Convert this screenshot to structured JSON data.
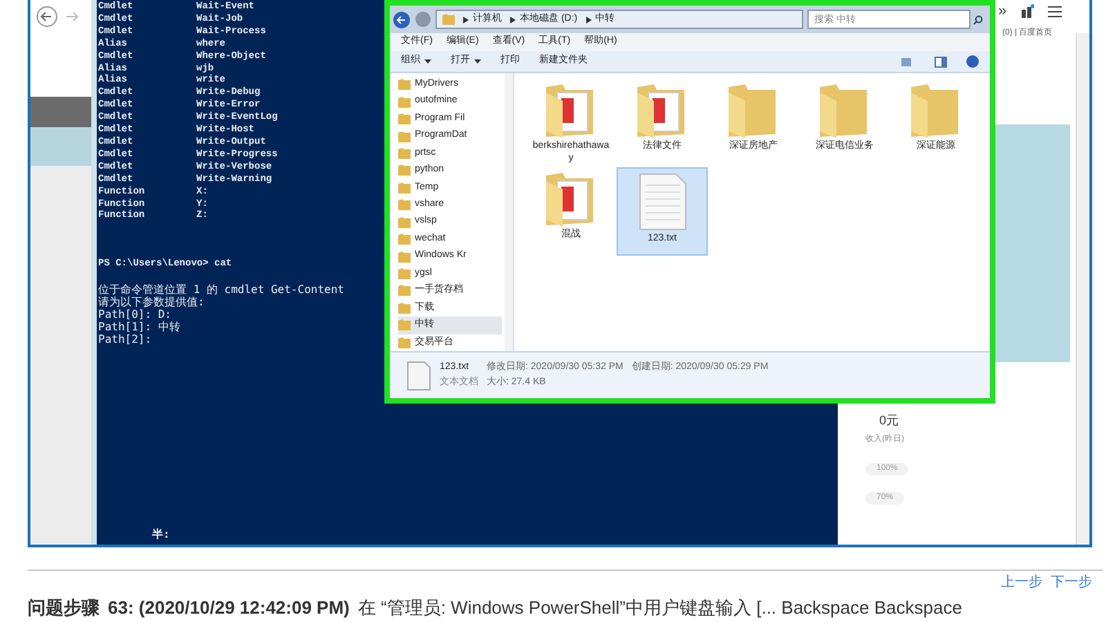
{
  "console": {
    "table": [
      {
        "type": "Cmdlet",
        "name": "Wait-Event"
      },
      {
        "type": "Cmdlet",
        "name": "Wait-Job"
      },
      {
        "type": "Cmdlet",
        "name": "Wait-Process"
      },
      {
        "type": "Alias",
        "name": "where"
      },
      {
        "type": "Cmdlet",
        "name": "Where-Object"
      },
      {
        "type": "Alias",
        "name": "wjb"
      },
      {
        "type": "Alias",
        "name": "write"
      },
      {
        "type": "Cmdlet",
        "name": "Write-Debug"
      },
      {
        "type": "Cmdlet",
        "name": "Write-Error"
      },
      {
        "type": "Cmdlet",
        "name": "Write-EventLog"
      },
      {
        "type": "Cmdlet",
        "name": "Write-Host"
      },
      {
        "type": "Cmdlet",
        "name": "Write-Output"
      },
      {
        "type": "Cmdlet",
        "name": "Write-Progress"
      },
      {
        "type": "Cmdlet",
        "name": "Write-Verbose"
      },
      {
        "type": "Cmdlet",
        "name": "Write-Warning"
      },
      {
        "type": "Function",
        "name": "X:"
      },
      {
        "type": "Function",
        "name": "Y:"
      },
      {
        "type": "Function",
        "name": "Z:"
      }
    ],
    "prompt": "PS C:\\Users\\Lenovo> cat",
    "lines": [
      "位于命令管道位置 1 的 cmdlet Get-Content",
      "请为以下参数提供值:",
      "Path[0]: D:",
      "Path[1]: 中转",
      "Path[2]:"
    ],
    "ime_status": "半:"
  },
  "explorer": {
    "breadcrumbs": [
      "计算机",
      "本地磁盘 (D:)",
      "中转"
    ],
    "search": {
      "placeholder": "搜索 中转"
    },
    "menu": [
      "文件(F)",
      "编辑(E)",
      "查看(V)",
      "工具(T)",
      "帮助(H)"
    ],
    "toolbar": [
      {
        "label": "组织",
        "dropdown": true
      },
      {
        "label": "打开",
        "dropdown": true
      },
      {
        "label": "打印",
        "dropdown": false
      },
      {
        "label": "新建文件夹",
        "dropdown": false
      }
    ],
    "nav": [
      {
        "label": "MyDrivers",
        "selected": false
      },
      {
        "label": "outofmine",
        "selected": false
      },
      {
        "label": "Program Fil",
        "selected": false
      },
      {
        "label": "ProgramDat",
        "selected": false
      },
      {
        "label": "prtsc",
        "selected": false
      },
      {
        "label": "python",
        "selected": false
      },
      {
        "label": "Temp",
        "selected": false
      },
      {
        "label": "vshare",
        "selected": false
      },
      {
        "label": "vslsp",
        "selected": false
      },
      {
        "label": "wechat",
        "selected": false
      },
      {
        "label": "Windows Kr",
        "selected": false
      },
      {
        "label": "ygsl",
        "selected": false
      },
      {
        "label": "一手货存档",
        "selected": false
      },
      {
        "label": "下载",
        "selected": false
      },
      {
        "label": "中转",
        "selected": true
      },
      {
        "label": "交易平台",
        "selected": false
      }
    ],
    "files": [
      {
        "name": "berkshirehathaway",
        "kind": "folder-docs",
        "selected": false
      },
      {
        "name": "法律文件",
        "kind": "folder-docs",
        "selected": false
      },
      {
        "name": "深证房地产",
        "kind": "folder",
        "selected": false
      },
      {
        "name": "深证电信业务",
        "kind": "folder",
        "selected": false
      },
      {
        "name": "深证能源",
        "kind": "folder",
        "selected": false
      },
      {
        "name": "混战",
        "kind": "folder-docs",
        "selected": false
      },
      {
        "name": "123.txt",
        "kind": "text-file",
        "selected": true
      }
    ],
    "details": {
      "name": "123.txt",
      "modified": "修改日期: 2020/09/30 05:32 PM",
      "created": "创建日期: 2020/09/30 05:29 PM",
      "type": "文本文档",
      "size": "大小: 27.4 KB"
    }
  },
  "browser": {
    "more": "»",
    "top_link": "(0) | 百度首页",
    "amount": "0元",
    "amount_label": "收入(昨日)",
    "percents": [
      "100%",
      "70%"
    ]
  },
  "step": {
    "label": "问题步骤",
    "number": "63: (2020/10/29 12:42:09 PM)",
    "text": "在 “管理员: Windows PowerShell”中用户键盘输入  [... Backspace Backspace",
    "prev": "上一步",
    "next": "下一步"
  }
}
